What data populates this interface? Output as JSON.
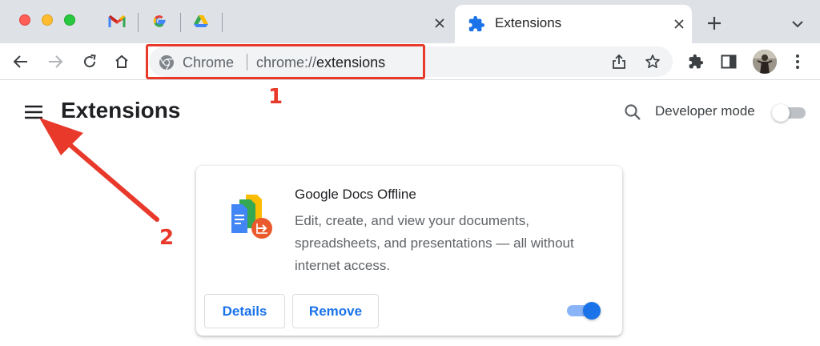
{
  "window": {
    "pinned_tabs": [
      "gmail-icon",
      "google-icon",
      "google-drive-icon"
    ],
    "active_tab": {
      "title": "Extensions",
      "icon": "puzzle-icon"
    }
  },
  "omnibox": {
    "site_label": "Chrome",
    "url_scheme": "chrome://",
    "url_host": "extensions"
  },
  "annotations": {
    "callout_1": "1",
    "callout_2": "2",
    "color": "#e8392b"
  },
  "page": {
    "title": "Extensions",
    "developer_mode_label": "Developer mode",
    "developer_mode_enabled": false
  },
  "extension": {
    "name": "Google Docs Offline",
    "description": "Edit, create, and view your documents, spreadsheets, and presentations — all without internet access.",
    "details_label": "Details",
    "remove_label": "Remove",
    "enabled": true
  },
  "colors": {
    "accent": "#1a73e8",
    "toggle_track_on": "#8ab4f8"
  }
}
